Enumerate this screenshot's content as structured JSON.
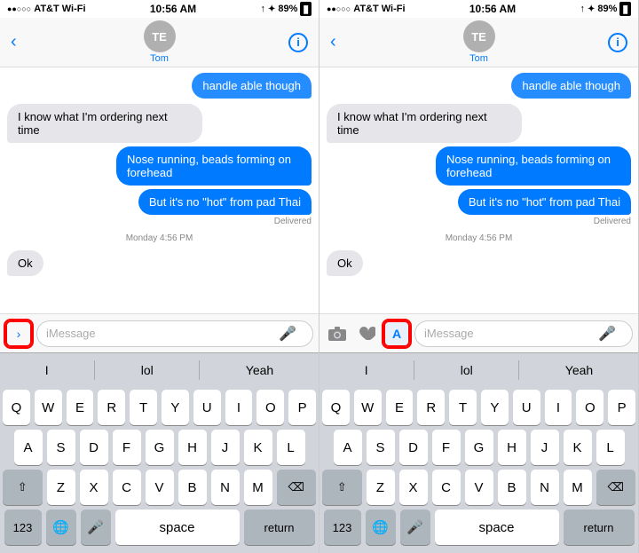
{
  "panels": [
    {
      "id": "panel-left",
      "statusBar": {
        "left": "●●○○○ AT&T Wi-Fi ↑",
        "center": "10:56 AM",
        "right": "↑ ✦ ⬛ 89%"
      },
      "nav": {
        "back": "‹",
        "avatarInitials": "TE",
        "name": "Tom",
        "infoIcon": "i"
      },
      "messages": [
        {
          "type": "partial-blue",
          "text": "handle able though"
        },
        {
          "type": "incoming",
          "text": "I know what I'm ordering next time"
        },
        {
          "type": "outgoing",
          "text": "Nose running, beads forming on forehead"
        },
        {
          "type": "outgoing",
          "text": "But it's no \"hot\" from pad Thai"
        },
        {
          "type": "delivered",
          "text": "Delivered"
        },
        {
          "type": "timestamp",
          "text": "Monday 4:56 PM"
        },
        {
          "type": "incoming",
          "text": "Ok"
        }
      ],
      "input": {
        "expandIcon": "›",
        "placeholder": "iMessage",
        "micIcon": "🎤",
        "hasExpandBtn": true,
        "hasCameraBtn": false,
        "hasHeartBtn": false,
        "expandHighlighted": false,
        "appHighlighted": false
      },
      "autocomplete": [
        "I",
        "lol",
        "Yeah"
      ],
      "keyboard": {
        "rows": [
          [
            "Q",
            "W",
            "E",
            "R",
            "T",
            "Y",
            "U",
            "I",
            "O",
            "P"
          ],
          [
            "A",
            "S",
            "D",
            "F",
            "G",
            "H",
            "J",
            "K",
            "L"
          ],
          [
            "⇧",
            "Z",
            "X",
            "C",
            "V",
            "B",
            "N",
            "M",
            "⌫"
          ],
          [
            "123",
            "🌐",
            "🎤",
            "space",
            "return"
          ]
        ]
      }
    },
    {
      "id": "panel-right",
      "statusBar": {
        "left": "●●○○○ AT&T Wi-Fi ↑",
        "center": "10:56 AM",
        "right": "↑ ✦ ⬛ 89%"
      },
      "nav": {
        "back": "‹",
        "avatarInitials": "TE",
        "name": "Tom",
        "infoIcon": "i"
      },
      "messages": [
        {
          "type": "partial-blue",
          "text": "handle able though"
        },
        {
          "type": "incoming",
          "text": "I know what I'm ordering next time"
        },
        {
          "type": "outgoing",
          "text": "Nose running, beads forming on forehead"
        },
        {
          "type": "outgoing",
          "text": "But it's no \"hot\" from pad Thai"
        },
        {
          "type": "delivered",
          "text": "Delivered"
        },
        {
          "type": "timestamp",
          "text": "Monday 4:56 PM"
        },
        {
          "type": "incoming",
          "text": "Ok"
        }
      ],
      "input": {
        "cameraIcon": "📷",
        "heartIcon": "♡",
        "appIcon": "A",
        "placeholder": "iMessage",
        "micIcon": "🎤",
        "hasExpandBtn": false,
        "hasCameraBtn": true,
        "hasHeartBtn": true,
        "appHighlighted": true
      },
      "autocomplete": [
        "I",
        "lol",
        "Yeah"
      ],
      "keyboard": {
        "rows": [
          [
            "Q",
            "W",
            "E",
            "R",
            "T",
            "Y",
            "U",
            "I",
            "O",
            "P"
          ],
          [
            "A",
            "S",
            "D",
            "F",
            "G",
            "H",
            "J",
            "K",
            "L"
          ],
          [
            "⇧",
            "Z",
            "X",
            "C",
            "V",
            "B",
            "N",
            "M",
            "⌫"
          ],
          [
            "123",
            "🌐",
            "🎤",
            "space",
            "return"
          ]
        ]
      }
    }
  ]
}
